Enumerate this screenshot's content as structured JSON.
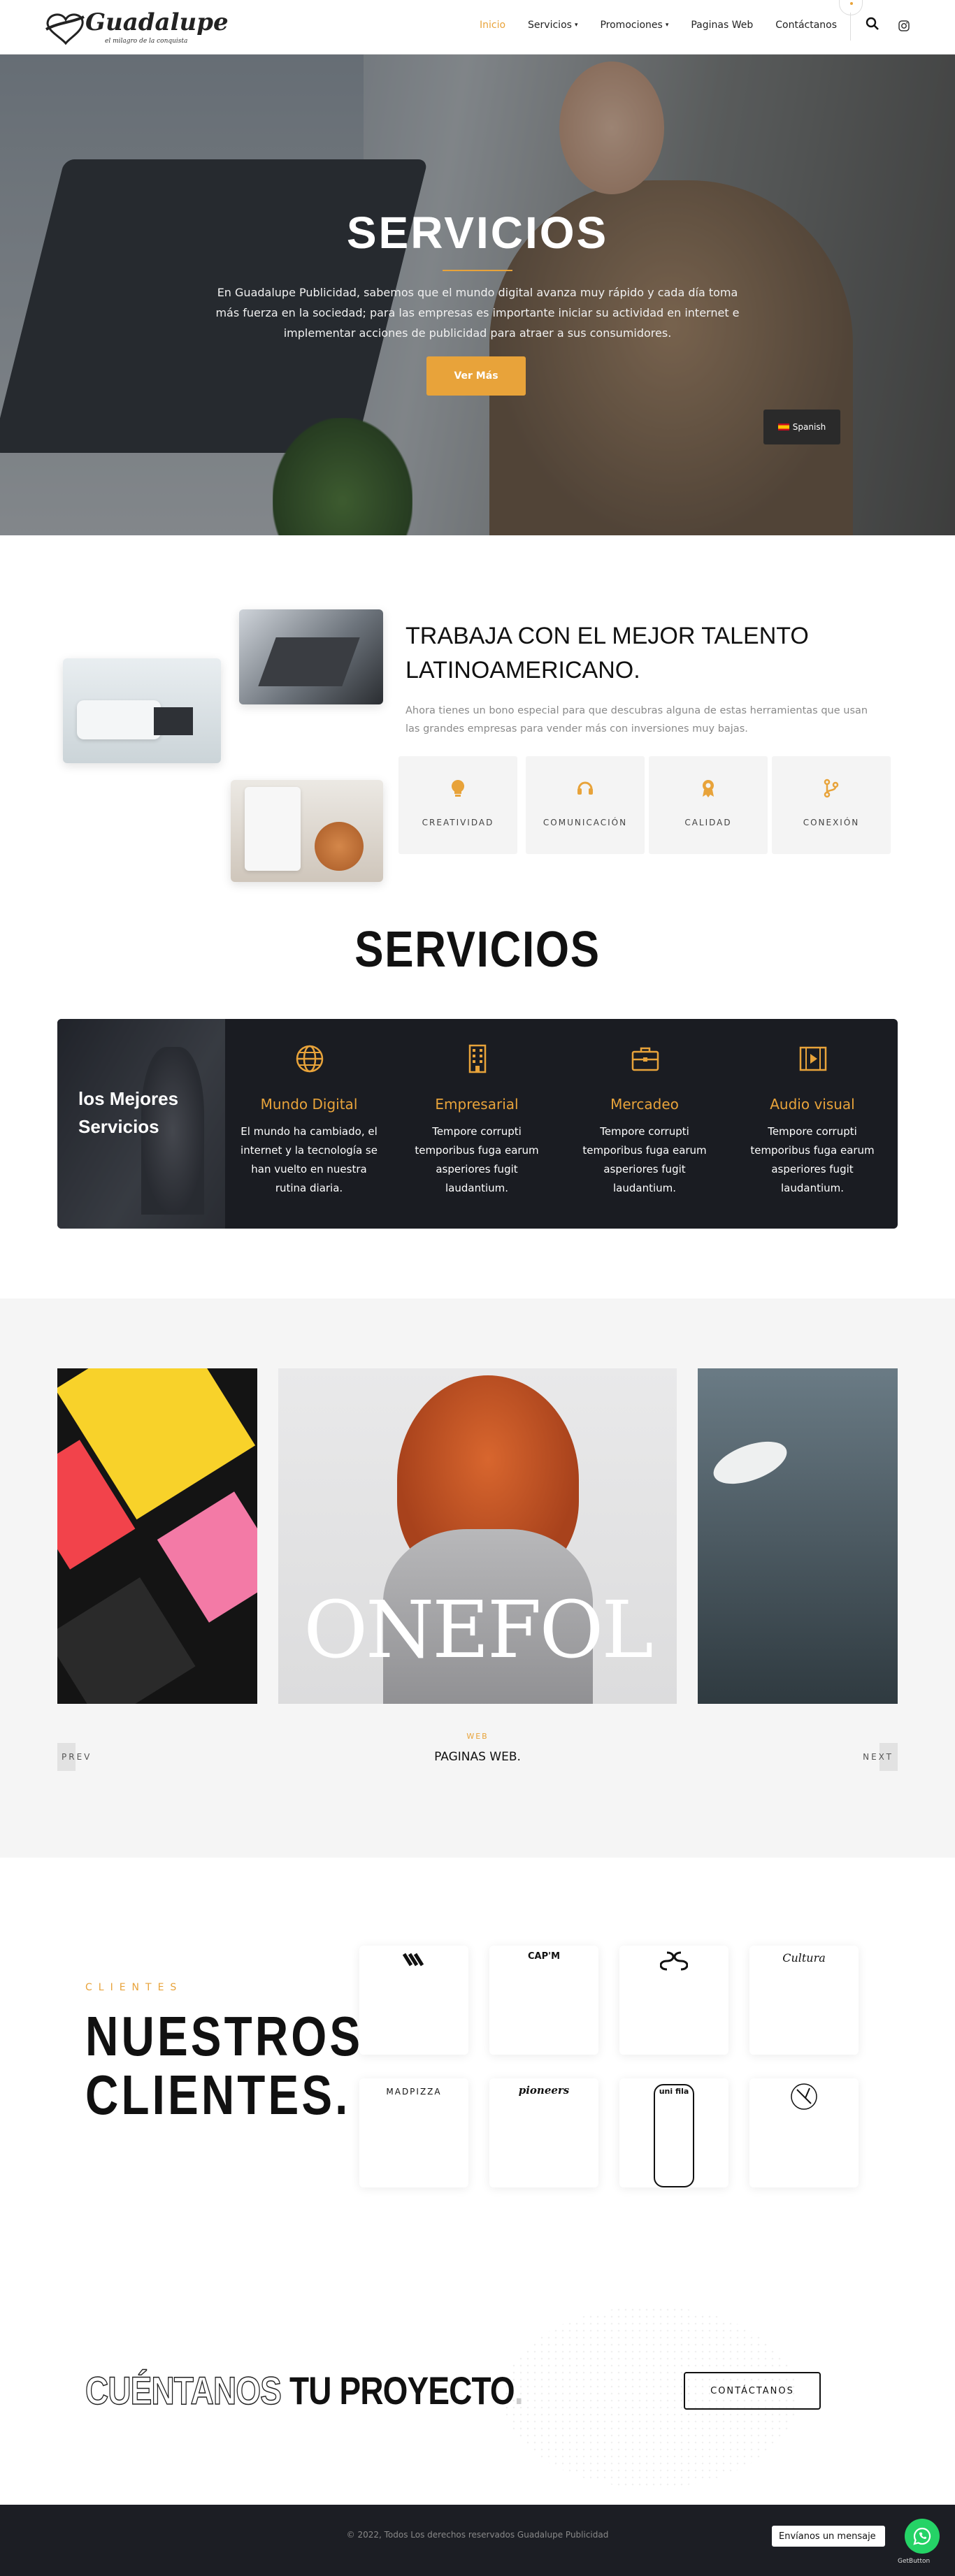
{
  "header": {
    "logo": {
      "name": "Guadalupe",
      "tagline": "el milagro de la conquista"
    },
    "nav": [
      {
        "label": "Inicio",
        "has_dropdown": false,
        "active": true
      },
      {
        "label": "Servicios",
        "has_dropdown": true,
        "active": false
      },
      {
        "label": "Promociones",
        "has_dropdown": true,
        "active": false
      },
      {
        "label": "Paginas Web",
        "has_dropdown": false,
        "active": false
      },
      {
        "label": "Contáctanos",
        "has_dropdown": false,
        "active": false
      }
    ],
    "search_icon": "search-icon",
    "social_icon": "instagram-icon"
  },
  "hero": {
    "title": "SERVICIOS",
    "text": "En Guadalupe Publicidad, sabemos que el mundo digital avanza muy rápido y cada día toma más fuerza en la sociedad; para las empresas es importante iniciar su actividad en internet e implementar acciones de publicidad para atraer a sus consumidores.",
    "button": "Ver Más",
    "language": "Spanish"
  },
  "talent": {
    "title": "TRABAJA CON EL MEJOR TALENTO LATINOAMERICANO.",
    "text": "Ahora tienes un bono especial para que descubras alguna de estas herramientas que usan las grandes empresas para vender más con inversiones muy bajas.",
    "features": [
      {
        "label": "CREATIVIDAD",
        "icon": "lightbulb-icon"
      },
      {
        "label": "COMUNICACIÓN",
        "icon": "headset-icon"
      },
      {
        "label": "CALIDAD",
        "icon": "award-icon"
      },
      {
        "label": "CONEXIÓN",
        "icon": "branch-icon"
      }
    ]
  },
  "services": {
    "title": "SERVICIOS",
    "side_title": "los Mejores Servicios",
    "items": [
      {
        "title": "Mundo Digital",
        "text": "El mundo ha cambiado, el internet y la tecnología se han vuelto en nuestra rutina diaria.",
        "icon": "globe-icon"
      },
      {
        "title": "Empresarial",
        "text": "Tempore corrupti temporibus fuga earum asperiores fugit laudantium.",
        "icon": "building-icon"
      },
      {
        "title": "Mercadeo",
        "text": "Tempore corrupti temporibus fuga earum asperiores fugit laudantium.",
        "icon": "briefcase-icon"
      },
      {
        "title": "Audio visual",
        "text": "Tempore corrupti temporibus fuga earum asperiores fugit laudantium.",
        "icon": "film-icon"
      }
    ]
  },
  "portfolio": {
    "slide_text": "ONEFOL",
    "category": "WEB",
    "title": "PAGINAS WEB.",
    "prev": "PREV",
    "next": "NEXT"
  },
  "clients": {
    "label": "CLIENTES",
    "title_line1": "NUESTROS",
    "title_line2": "CLIENTES.",
    "logos": [
      "",
      "CAP'M",
      "",
      "Cultura",
      "MADPIZZA",
      "pioneers",
      "uni fila",
      ""
    ]
  },
  "cta": {
    "outline": "CUÉNTANOS",
    "solid": "TU PROYECTO",
    "dot": ".",
    "button": "CONTÁCTANOS"
  },
  "footer": {
    "text": "© 2022, Todos Los derechos reservados Guadalupe Publicidad"
  },
  "whatsapp": {
    "label": "Envíanos un mensaje",
    "brand": "GetButton"
  },
  "colors": {
    "accent": "#e8a33a",
    "dark": "#1a1c22",
    "footer": "#1c1e24",
    "whatsapp": "#25d366"
  }
}
